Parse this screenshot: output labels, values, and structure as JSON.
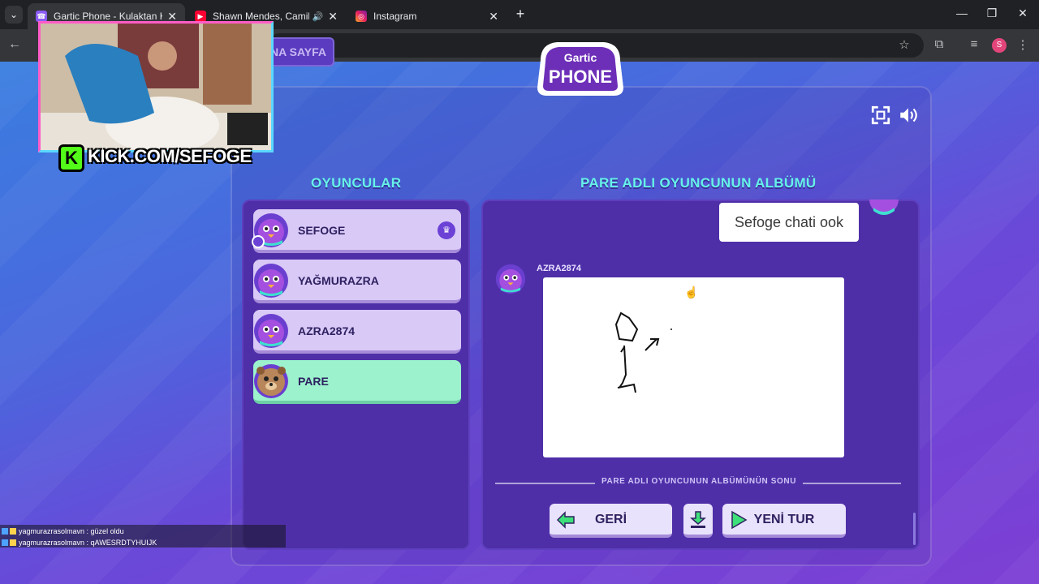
{
  "browser": {
    "tabs": [
      {
        "title": "Gartic Phone - Kulaktan Kulağa",
        "icon": "phone-icon",
        "active": true
      },
      {
        "title": "Shawn Mendes, Camila Cab",
        "icon": "youtube-icon",
        "active": false,
        "audio": true
      },
      {
        "title": "Instagram",
        "icon": "instagram-icon",
        "active": false
      }
    ],
    "profile_initial": "S"
  },
  "game": {
    "home_button": "ANA SAYFA",
    "logo_top": "Gartic",
    "logo_bottom": "PHONE",
    "players_title": "OYUNCULAR",
    "album_title": "PARE ADLI OYUNCUNUN ALBÜMÜ",
    "players": [
      {
        "name": "SEFOGE",
        "avatar": "purple-bird",
        "host": true
      },
      {
        "name": "YAĞMURAZRA",
        "avatar": "purple-bird",
        "host": false
      },
      {
        "name": "AZRA2874",
        "avatar": "purple-bird",
        "host": false
      },
      {
        "name": "PARE",
        "avatar": "brown-bear",
        "host": false,
        "highlighted": true
      }
    ],
    "album": {
      "previous_text": "Sefoge chati ook",
      "drawing_author": "AZRA2874",
      "end_label": "PARE ADLI OYUNCUNUN ALBÜMÜNÜN SONU"
    },
    "buttons": {
      "back": "GERİ",
      "new_round": "YENİ TUR"
    },
    "colors": {
      "accent_teal": "#66f2e8",
      "player_card": "#d9c9f7",
      "highlight": "#9cf2cd",
      "panel": "#4e2fa8"
    }
  },
  "stream": {
    "kick_text": "KICK.COM/SEFOGE",
    "chat": [
      {
        "user": "yagmurazrasolmavn",
        "message": "güzel oldu"
      },
      {
        "user": "yagmurazrasolmavn",
        "message": "qAWESRDTYHUIJK"
      }
    ]
  }
}
